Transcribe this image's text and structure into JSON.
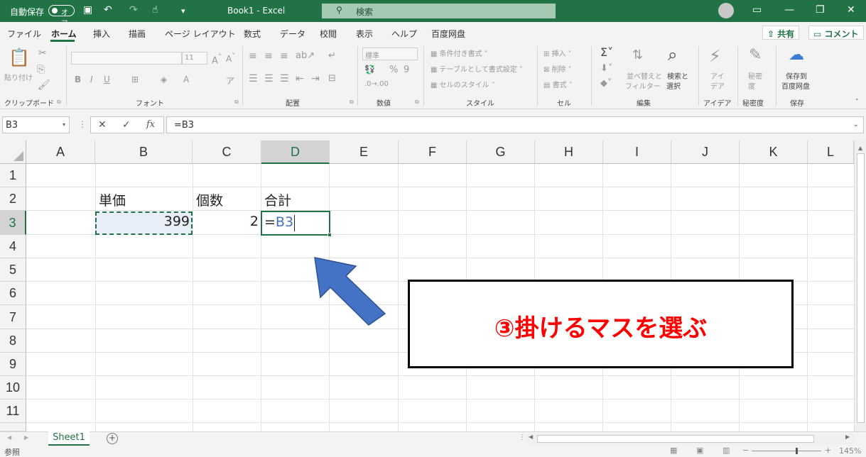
{
  "titlebar": {
    "autosave_label": "自動保存",
    "autosave_state": "オフ",
    "doc_title": "Book1 - Excel",
    "search_placeholder": "検索"
  },
  "tabs": [
    "ファイル",
    "ホーム",
    "挿入",
    "描画",
    "ページ レイアウト",
    "数式",
    "データ",
    "校閲",
    "表示",
    "ヘルプ",
    "百度网盘"
  ],
  "share_label": "共有",
  "comment_label": "コメント",
  "ribbon": {
    "clipboard": {
      "paste": "貼り付け",
      "label": "クリップボード"
    },
    "font": {
      "size": "11",
      "label": "フォント"
    },
    "alignment": {
      "label": "配置"
    },
    "number": {
      "format": "標準",
      "label": "数値"
    },
    "styles": {
      "conditional": "条件付き書式",
      "table": "テーブルとして書式設定",
      "cell_styles": "セルのスタイル",
      "label": "スタイル"
    },
    "cells": {
      "insert": "挿入",
      "delete": "削除",
      "format": "書式",
      "label": "セル"
    },
    "editing": {
      "sort": "並べ替えと",
      "filter": "フィルター",
      "find": "検索と",
      "select": "選択",
      "label": "編集"
    },
    "ideas": {
      "line1": "アイ",
      "line2": "デア",
      "label": "アイデア"
    },
    "sensitivity": {
      "line1": "秘密",
      "line2": "度",
      "label": "秘密度"
    },
    "save": {
      "line1": "保存到",
      "line2": "百度网盘",
      "label": "保存"
    }
  },
  "formula_bar": {
    "name_box": "B3",
    "formula": "=B3",
    "fx": "fx"
  },
  "columns": [
    "A",
    "B",
    "C",
    "D",
    "E",
    "F",
    "G",
    "H",
    "I",
    "J",
    "K",
    "L"
  ],
  "rows": [
    "1",
    "2",
    "3",
    "4",
    "5",
    "6",
    "7",
    "8",
    "9",
    "10",
    "11"
  ],
  "cells": {
    "B2": "単価",
    "C2": "個数",
    "D2": "合計",
    "B3": "399",
    "C3": "2",
    "D3_eq": "=",
    "D3_ref": "B3"
  },
  "annotation": "③掛けるマスを選ぶ",
  "sheet_tab": "Sheet1",
  "status": {
    "mode": "参照",
    "zoom": "145%"
  },
  "colors": {
    "excel_green": "#217346",
    "arrow": "#4472c4",
    "annotation_text": "#ff0000",
    "ref_text": "#4472c4"
  }
}
